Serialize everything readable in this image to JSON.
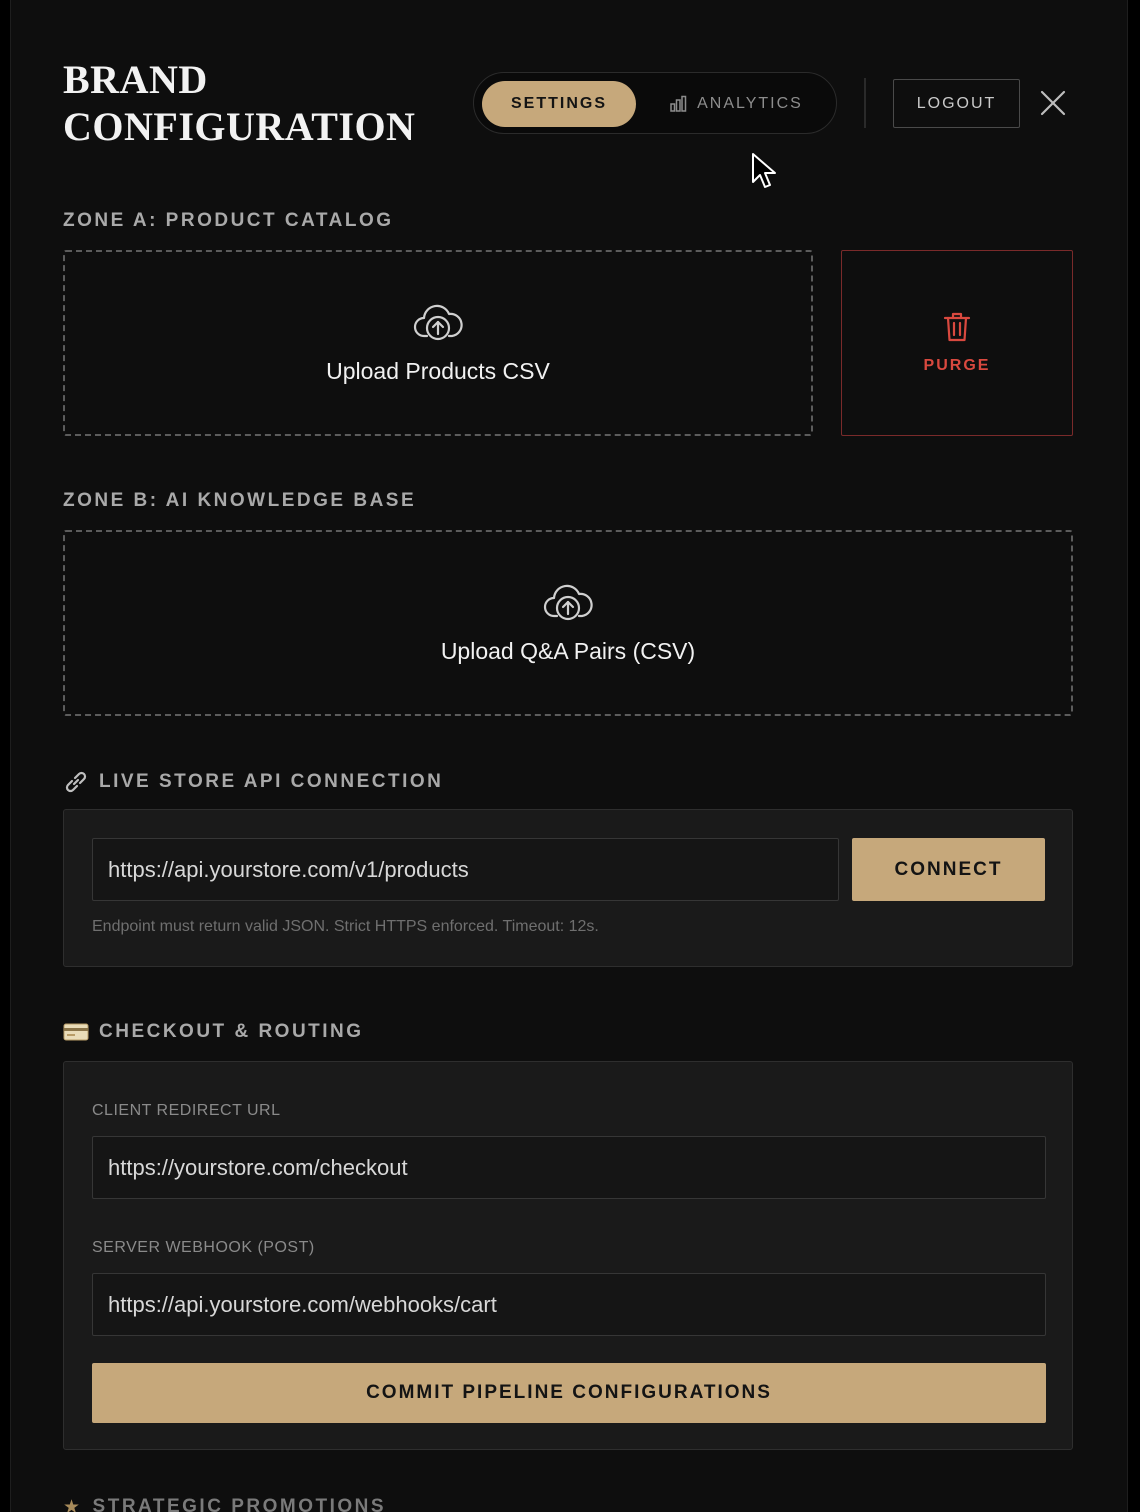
{
  "header": {
    "title_line1": "BRAND",
    "title_line2": "CONFIGURATION",
    "tabs": [
      {
        "label": "SETTINGS",
        "active": true
      },
      {
        "label": "ANALYTICS",
        "active": false,
        "icon": "bar-chart-icon"
      }
    ],
    "logout_label": "LOGOUT",
    "close_icon": "close-icon"
  },
  "zone_a": {
    "label": "ZONE A: PRODUCT CATALOG",
    "upload_label": "Upload Products CSV",
    "upload_icon": "cloud-upload-icon",
    "purge_label": "PURGE",
    "purge_icon": "trash-icon"
  },
  "zone_b": {
    "label": "ZONE B: AI KNOWLEDGE BASE",
    "upload_label": "Upload Q&A Pairs (CSV)",
    "upload_icon": "cloud-upload-icon"
  },
  "api": {
    "label": "LIVE STORE API CONNECTION",
    "icon": "link-icon",
    "endpoint_value": "https://api.yourstore.com/v1/products",
    "connect_label": "CONNECT",
    "hint": "Endpoint must return valid JSON. Strict HTTPS enforced. Timeout: 12s."
  },
  "checkout": {
    "label": "CHECKOUT & ROUTING",
    "icon": "credit-card-icon",
    "redirect_label": "CLIENT REDIRECT URL",
    "redirect_value": "https://yourstore.com/checkout",
    "webhook_label": "SERVER WEBHOOK (POST)",
    "webhook_value": "https://api.yourstore.com/webhooks/cart",
    "commit_label": "COMMIT PIPELINE CONFIGURATIONS"
  },
  "next_section": {
    "label": "STRATEGIC PROMOTIONS"
  },
  "colors": {
    "accent": "#c6a87b",
    "danger": "#d9493f",
    "background": "#0e0e0e"
  }
}
